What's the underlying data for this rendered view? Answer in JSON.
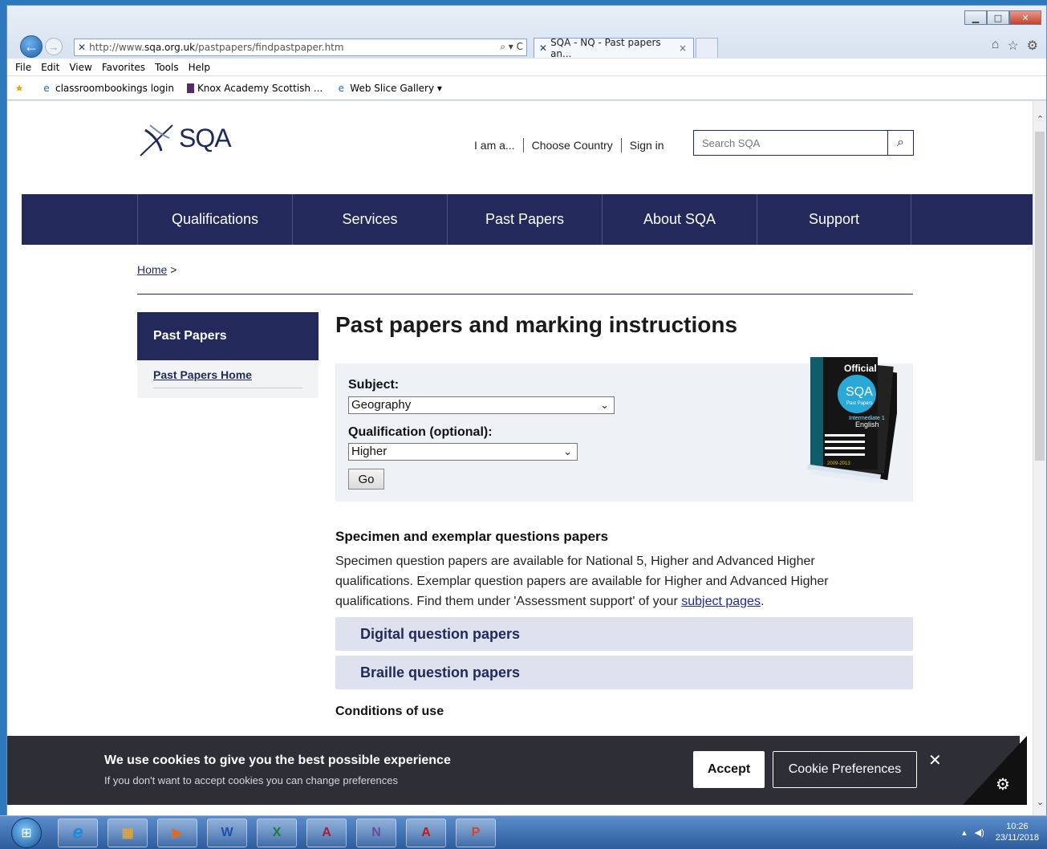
{
  "browser": {
    "url_prefix": "http://www.",
    "url_host": "sqa.org.uk",
    "url_path": "/pastpapers/findpastpaper.htm",
    "address_tools": "⌕ ▾ C",
    "tab_title": "SQA - NQ - Past papers an...",
    "tab_close": "×",
    "menu": [
      "File",
      "Edit",
      "View",
      "Favorites",
      "Tools",
      "Help"
    ],
    "favorites": [
      "classroombookings login",
      "Knox Academy Scottish ...",
      "Web Slice Gallery ▾"
    ]
  },
  "site": {
    "logo_text": "SQA",
    "header_links": [
      "I am a...",
      "Choose Country",
      "Sign in"
    ],
    "search_placeholder": "Search SQA",
    "nav": [
      "Qualifications",
      "Services",
      "Past Papers",
      "About SQA",
      "Support"
    ],
    "breadcrumb_home": "Home",
    "breadcrumb_sep": " >"
  },
  "sidebar": {
    "heading": "Past Papers",
    "link": "Past Papers Home"
  },
  "main": {
    "title": "Past papers and marking instructions",
    "subject_label": "Subject:",
    "subject_value": "Geography",
    "qualification_label": "Qualification (optional):",
    "qualification_value": "Higher",
    "go_label": "Go",
    "book": {
      "official": "Official",
      "sqa": "SQA",
      "past_papers": "Past Papers",
      "level": "Intermediate 1",
      "subject": "English",
      "years": "2009-2013"
    },
    "specimen_title": "Specimen and exemplar questions papers",
    "specimen_text_1": "Specimen question papers are available for National 5, Higher and Advanced Higher qualifications. Exemplar question papers are available for Higher and Advanced Higher qualifications. Find them under 'Assessment support' of your ",
    "specimen_link": "subject pages",
    "specimen_text_2": ".",
    "accordion_1": "Digital question papers",
    "accordion_2": "Braille question papers",
    "conditions": "Conditions of use"
  },
  "cookie": {
    "title": "We use cookies to give you the best possible experience",
    "subtitle": "If you don't want to accept cookies you can change preferences",
    "accept": "Accept",
    "preferences": "Cookie Preferences",
    "close": "✕"
  },
  "taskbar": {
    "time": "10:26",
    "date": "23/11/2018"
  }
}
